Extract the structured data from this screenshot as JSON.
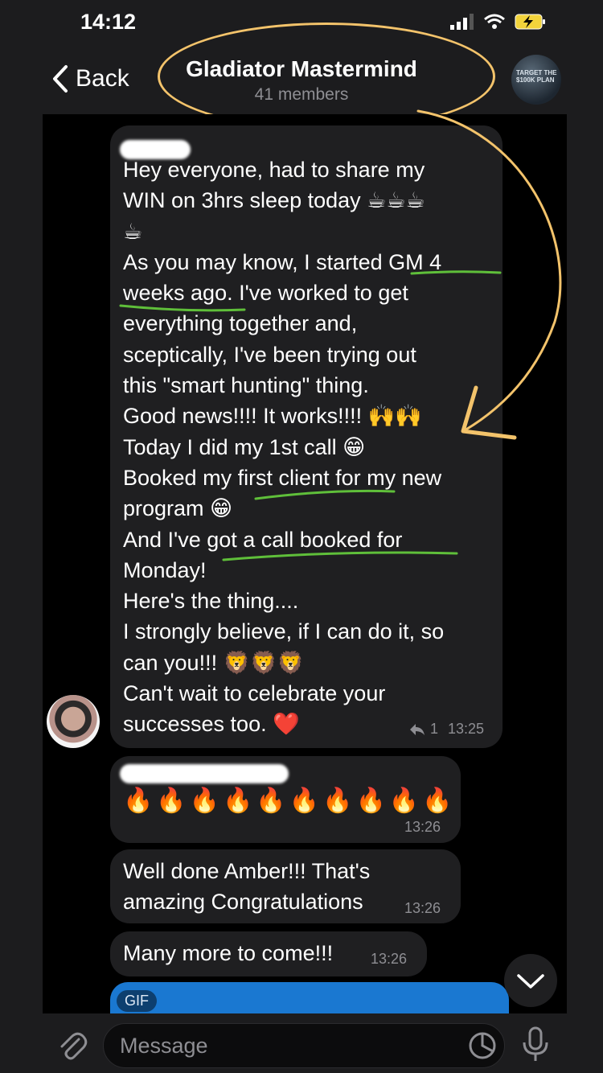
{
  "status_bar": {
    "time": "14:12"
  },
  "header": {
    "back_label": "Back",
    "title": "Gladiator Mastermind",
    "subtitle": "41 members",
    "avatar_text": "TARGET THE $100K PLAN"
  },
  "messages": [
    {
      "text": "Hey everyone, had to share my\nWIN on 3hrs sleep today ☕☕☕\n☕\nAs you may know, I started GM 4\nweeks ago. I've worked to get\neverything together and,\nsceptically,  I've been trying out\nthis \"smart hunting\" thing.\nGood news!!!! It works!!!! 🙌🙌\nToday I did my 1st call 😁\nBooked my first client for my new\nprogram 😁\nAnd I've got a call booked for\nMonday!\nHere's the thing....\nI strongly believe, if I can do it, so\ncan you!!! 🦁🦁🦁\nCan't wait to celebrate your\nsuccesses too.  ❤️",
      "reply_count": "1",
      "time": "13:25"
    },
    {
      "text": "🔥🔥🔥🔥🔥🔥🔥🔥🔥🔥",
      "time": "13:26"
    },
    {
      "text": "Well done Amber!!! That's\namazing Congratulations",
      "time": "13:26"
    },
    {
      "text": "Many more to come!!!",
      "time": "13:26"
    }
  ],
  "gif_label": "GIF",
  "input": {
    "placeholder": "Message"
  },
  "colors": {
    "annotation": "#f3c36b",
    "underline": "#5fbf3a",
    "gif_blue": "#1a78d1"
  }
}
